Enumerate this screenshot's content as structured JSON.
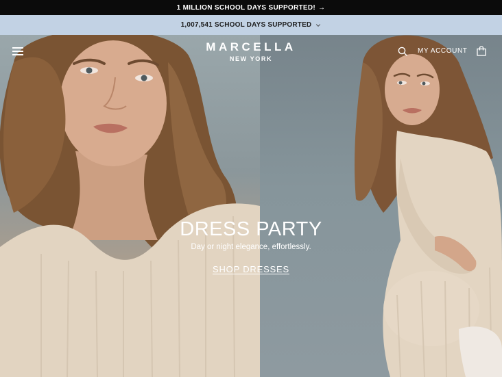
{
  "promo": {
    "text": "1 MILLION SCHOOL DAYS SUPPORTED!",
    "arrow": "→"
  },
  "counter": {
    "text": "1,007,541 SCHOOL DAYS SUPPORTED"
  },
  "header": {
    "brand": "MARCELLA",
    "brand_sub": "NEW YORK",
    "account_label": "MY ACCOUNT"
  },
  "hero": {
    "title": "DRESS PARTY",
    "subtitle": "Day or night elegance, effortlessly.",
    "cta": "SHOP DRESSES"
  },
  "colors": {
    "promo_bg": "#0b0b0b",
    "counter_bg": "#c2d2e4",
    "dress": "#e2d4c1",
    "hair": "#7a5433"
  },
  "icons": [
    "menu-icon",
    "search-icon",
    "shopping-bag-icon",
    "chevron-down-icon",
    "arrow-right-icon"
  ]
}
